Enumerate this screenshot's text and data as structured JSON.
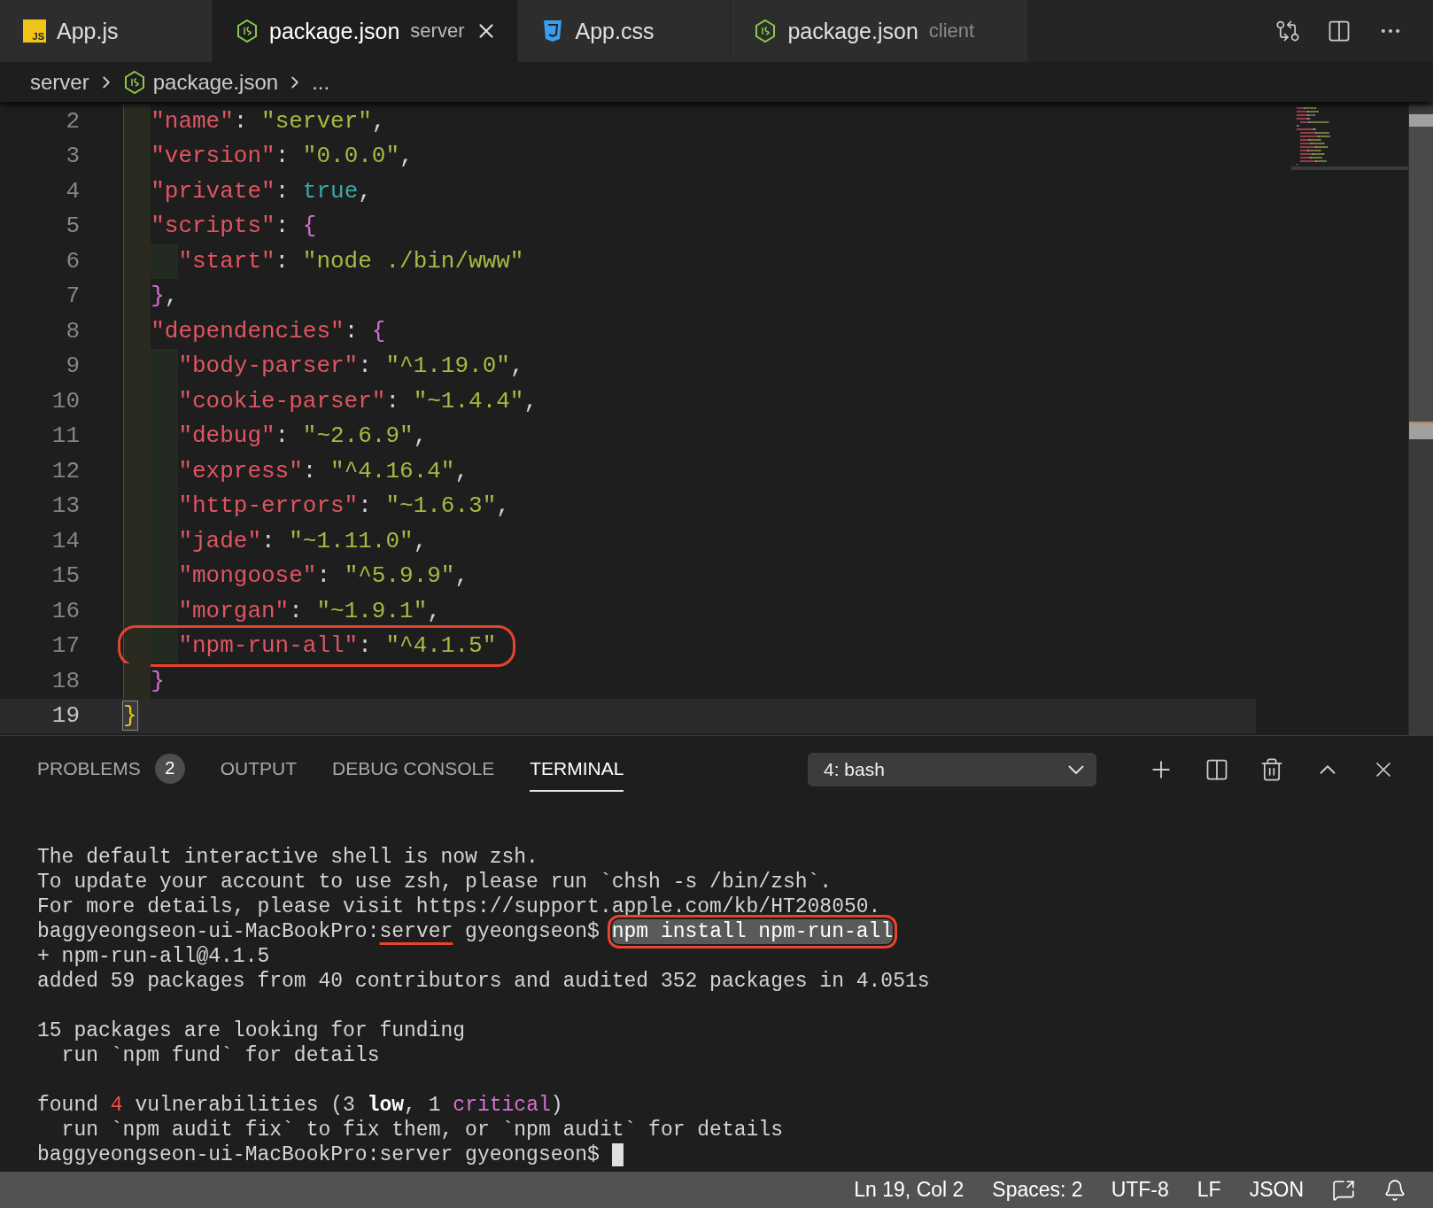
{
  "tabs": [
    {
      "label": "App.js",
      "kind": "js",
      "icon_text": "JS",
      "selected": false
    },
    {
      "label": "package.json",
      "description": "server",
      "kind": "node",
      "selected": true
    },
    {
      "label": "App.css",
      "kind": "css",
      "selected": false
    },
    {
      "label": "package.json",
      "description": "client",
      "kind": "node",
      "selected": false
    }
  ],
  "breadcrumb": [
    {
      "label": "server",
      "kind": "folder"
    },
    {
      "label": "package.json",
      "kind": "node"
    },
    {
      "label": "...",
      "kind": "symbol"
    }
  ],
  "code_lines": [
    {
      "children": [
        {
          "number": "2",
          "current": false,
          "circled": false,
          "tokens": [
            {
              "kind": "key",
              "text": "\"name\""
            },
            {
              "kind": "punct",
              "text": ": "
            },
            {
              "kind": "string",
              "text": "\"server\""
            },
            {
              "kind": "punct",
              "text": ","
            }
          ]
        },
        {
          "number": "3",
          "current": false,
          "circled": false,
          "tokens": [
            {
              "kind": "key",
              "text": "\"version\""
            },
            {
              "kind": "punct",
              "text": ": "
            },
            {
              "kind": "string",
              "text": "\"0.0.0\""
            },
            {
              "kind": "punct",
              "text": ","
            }
          ]
        },
        {
          "number": "4",
          "current": false,
          "circled": false,
          "tokens": [
            {
              "kind": "key",
              "text": "\"private\""
            },
            {
              "kind": "punct",
              "text": ": "
            },
            {
              "kind": "bool",
              "text": "true"
            },
            {
              "kind": "punct",
              "text": ","
            }
          ]
        },
        {
          "number": "5",
          "current": false,
          "circled": false,
          "tokens": [
            {
              "kind": "key",
              "text": "\"scripts\""
            },
            {
              "kind": "punct",
              "text": ": "
            },
            {
              "kind": "brace",
              "text": "{"
            }
          ],
          "children": [
            {
              "number": "6",
              "current": false,
              "circled": false,
              "tokens": [
                {
                  "kind": "key",
                  "text": "\"start\""
                },
                {
                  "kind": "punct",
                  "text": ": "
                },
                {
                  "kind": "string",
                  "text": "\"node ./bin/www\""
                }
              ]
            }
          ]
        },
        {
          "number": "7",
          "current": false,
          "circled": false,
          "tokens": [
            {
              "kind": "brace",
              "text": "}"
            },
            {
              "kind": "punct",
              "text": ","
            }
          ]
        },
        {
          "number": "8",
          "current": false,
          "circled": false,
          "tokens": [
            {
              "kind": "key",
              "text": "\"dependencies\""
            },
            {
              "kind": "punct",
              "text": ": "
            },
            {
              "kind": "brace",
              "text": "{"
            }
          ],
          "children": [
            {
              "number": "9",
              "current": false,
              "circled": false,
              "tokens": [
                {
                  "kind": "key",
                  "text": "\"body-parser\""
                },
                {
                  "kind": "punct",
                  "text": ": "
                },
                {
                  "kind": "string",
                  "text": "\"^1.19.0\""
                },
                {
                  "kind": "punct",
                  "text": ","
                }
              ]
            },
            {
              "number": "10",
              "current": false,
              "circled": false,
              "tokens": [
                {
                  "kind": "key",
                  "text": "\"cookie-parser\""
                },
                {
                  "kind": "punct",
                  "text": ": "
                },
                {
                  "kind": "string",
                  "text": "\"~1.4.4\""
                },
                {
                  "kind": "punct",
                  "text": ","
                }
              ]
            },
            {
              "number": "11",
              "current": false,
              "circled": false,
              "tokens": [
                {
                  "kind": "key",
                  "text": "\"debug\""
                },
                {
                  "kind": "punct",
                  "text": ": "
                },
                {
                  "kind": "string",
                  "text": "\"~2.6.9\""
                },
                {
                  "kind": "punct",
                  "text": ","
                }
              ]
            },
            {
              "number": "12",
              "current": false,
              "circled": false,
              "tokens": [
                {
                  "kind": "key",
                  "text": "\"express\""
                },
                {
                  "kind": "punct",
                  "text": ": "
                },
                {
                  "kind": "string",
                  "text": "\"^4.16.4\""
                },
                {
                  "kind": "punct",
                  "text": ","
                }
              ]
            },
            {
              "number": "13",
              "current": false,
              "circled": false,
              "tokens": [
                {
                  "kind": "key",
                  "text": "\"http-errors\""
                },
                {
                  "kind": "punct",
                  "text": ": "
                },
                {
                  "kind": "string",
                  "text": "\"~1.6.3\""
                },
                {
                  "kind": "punct",
                  "text": ","
                }
              ]
            },
            {
              "number": "14",
              "current": false,
              "circled": false,
              "tokens": [
                {
                  "kind": "key",
                  "text": "\"jade\""
                },
                {
                  "kind": "punct",
                  "text": ": "
                },
                {
                  "kind": "string",
                  "text": "\"~1.11.0\""
                },
                {
                  "kind": "punct",
                  "text": ","
                }
              ]
            },
            {
              "number": "15",
              "current": false,
              "circled": false,
              "tokens": [
                {
                  "kind": "key",
                  "text": "\"mongoose\""
                },
                {
                  "kind": "punct",
                  "text": ": "
                },
                {
                  "kind": "string",
                  "text": "\"^5.9.9\""
                },
                {
                  "kind": "punct",
                  "text": ","
                }
              ]
            },
            {
              "number": "16",
              "current": false,
              "circled": false,
              "tokens": [
                {
                  "kind": "key",
                  "text": "\"morgan\""
                },
                {
                  "kind": "punct",
                  "text": ": "
                },
                {
                  "kind": "string",
                  "text": "\"~1.9.1\""
                },
                {
                  "kind": "punct",
                  "text": ","
                }
              ]
            },
            {
              "number": "17",
              "current": false,
              "circled": true,
              "tokens": [
                {
                  "kind": "key",
                  "text": "\"npm-run-all\""
                },
                {
                  "kind": "punct",
                  "text": ": "
                },
                {
                  "kind": "string",
                  "text": "\"^4.1.5\""
                }
              ]
            }
          ]
        },
        {
          "number": "18",
          "current": false,
          "circled": false,
          "tokens": [
            {
              "kind": "brace",
              "text": "}"
            }
          ]
        }
      ]
    },
    {
      "number": "19",
      "current": true,
      "circled": false,
      "tokens": [
        {
          "kind": "match",
          "text": "}"
        }
      ]
    }
  ],
  "panel": {
    "tabs": [
      {
        "label": "PROBLEMS",
        "badge": "2",
        "selected": false
      },
      {
        "label": "OUTPUT",
        "selected": false
      },
      {
        "label": "DEBUG CONSOLE",
        "selected": false
      },
      {
        "label": "TERMINAL",
        "selected": true
      }
    ],
    "terminal_select": "4: bash",
    "terminal_lines": [
      {
        "blank_before": false,
        "cursor": false,
        "segments": [
          {
            "kind": "plain",
            "text": "The default interactive shell is now zsh."
          }
        ]
      },
      {
        "blank_before": false,
        "cursor": false,
        "segments": [
          {
            "kind": "plain",
            "text": "To update your account to use zsh, please run `chsh -s /bin/zsh`."
          }
        ]
      },
      {
        "blank_before": false,
        "cursor": false,
        "segments": [
          {
            "kind": "plain",
            "text": "For more details, please visit https://support.apple.com/kb/HT208050."
          }
        ]
      },
      {
        "blank_before": false,
        "cursor": false,
        "segments": [
          {
            "kind": "plain",
            "text": "baggyeongseon-ui-MacBookPro:"
          },
          {
            "kind": "underlined",
            "text": "server"
          },
          {
            "kind": "plain",
            "text": " gyeongseon$ "
          },
          {
            "kind": "circled",
            "text": "npm install npm-run-all"
          }
        ]
      },
      {
        "blank_before": false,
        "cursor": false,
        "segments": [
          {
            "kind": "plain",
            "text": "+ npm-run-all@4.1.5"
          }
        ]
      },
      {
        "blank_before": false,
        "cursor": false,
        "segments": [
          {
            "kind": "plain",
            "text": "added 59 packages from 40 contributors and audited 352 packages in 4.051s"
          }
        ]
      },
      {
        "blank_before": true,
        "cursor": false,
        "segments": [
          {
            "kind": "plain",
            "text": "15 packages are looking for funding"
          }
        ]
      },
      {
        "blank_before": false,
        "cursor": false,
        "segments": [
          {
            "kind": "plain",
            "text": "  run `npm fund` for details"
          }
        ]
      },
      {
        "blank_before": true,
        "cursor": false,
        "segments": [
          {
            "kind": "plain",
            "text": "found "
          },
          {
            "kind": "red",
            "text": "4"
          },
          {
            "kind": "plain",
            "text": " vulnerabilities (3 "
          },
          {
            "kind": "bold",
            "text": "low"
          },
          {
            "kind": "plain",
            "text": ", 1 "
          },
          {
            "kind": "magenta",
            "text": "critical"
          },
          {
            "kind": "plain",
            "text": ")"
          }
        ]
      },
      {
        "blank_before": false,
        "cursor": false,
        "segments": [
          {
            "kind": "plain",
            "text": "  run `npm audit fix` to fix them, or `npm audit` for details"
          }
        ]
      },
      {
        "blank_before": false,
        "cursor": true,
        "segments": [
          {
            "kind": "plain",
            "text": "baggyeongseon-ui-MacBookPro:server gyeongseon$ "
          }
        ]
      }
    ]
  },
  "status_bar": [
    "Ln 19, Col 2",
    "Spaces: 2",
    "UTF-8",
    "LF",
    "JSON"
  ]
}
